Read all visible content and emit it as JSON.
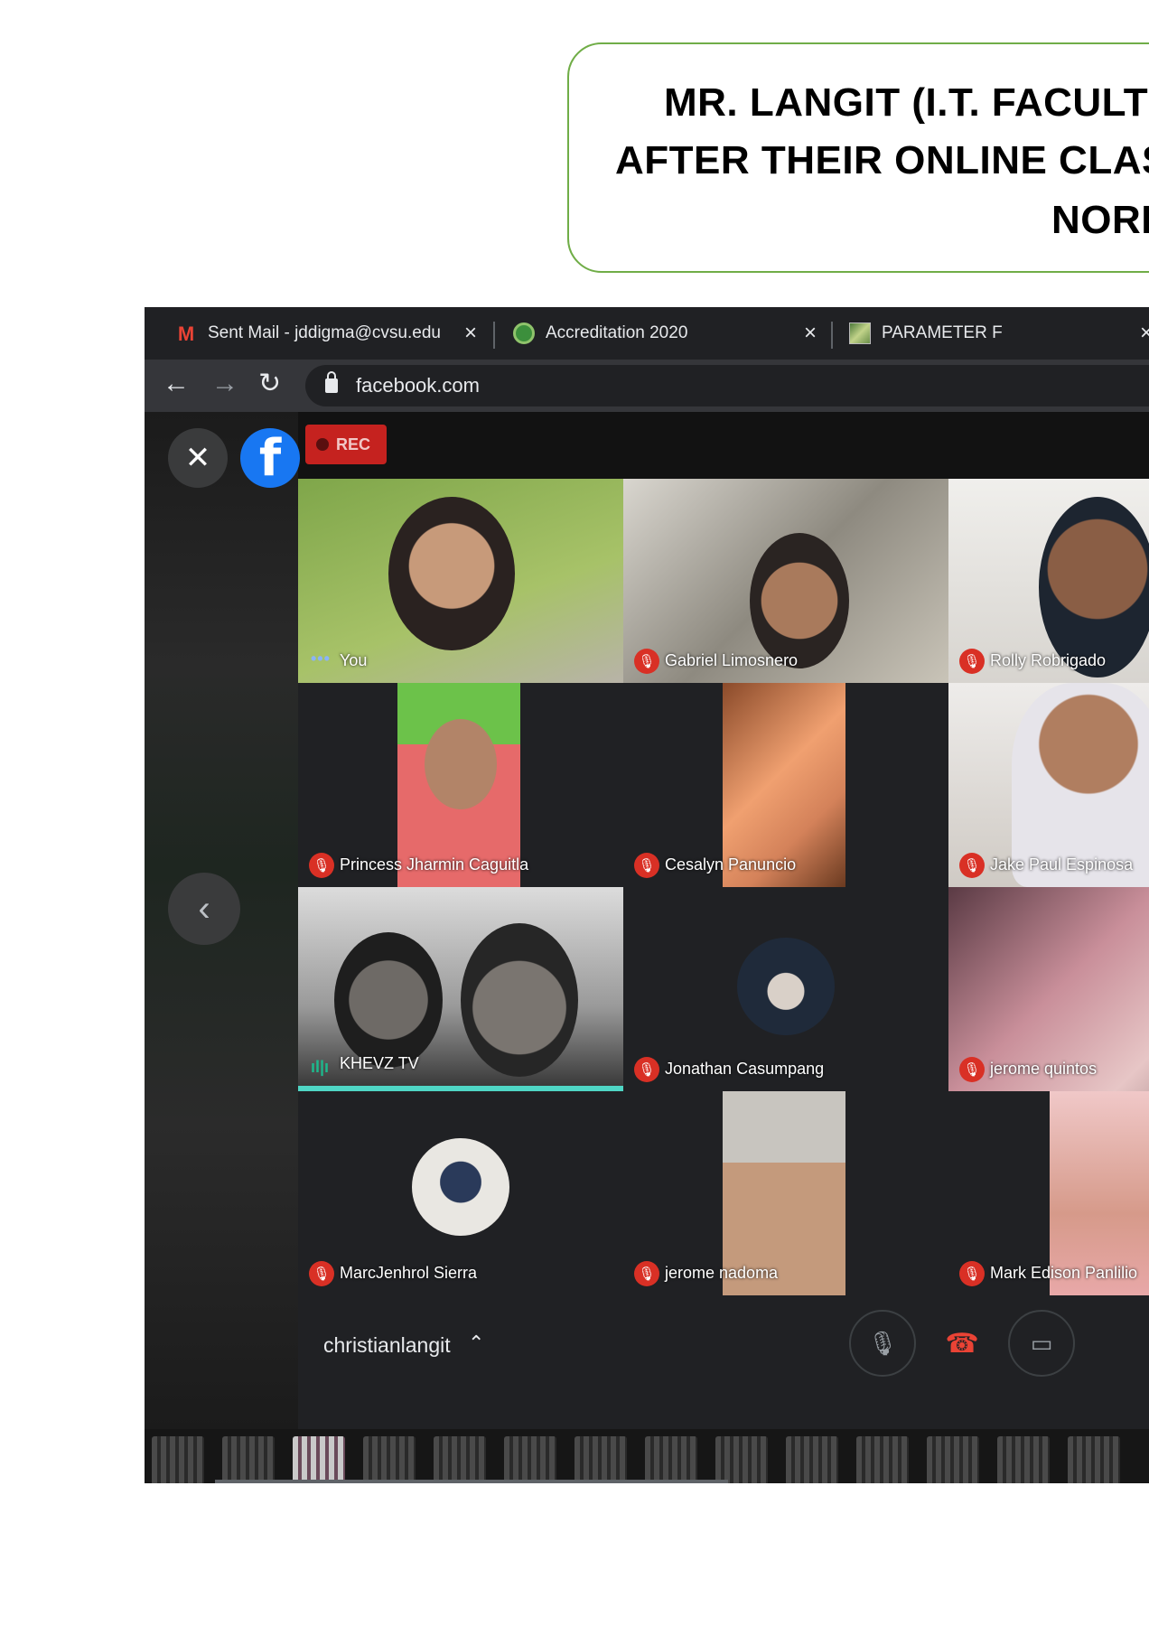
{
  "caption": {
    "line1": "MR. LANGIT (I.T. FACULT",
    "line2": "AFTER THEIR ONLINE CLAS",
    "line3": "NORI"
  },
  "browser": {
    "tabs": [
      {
        "title": "Sent Mail - jddigma@cvsu.edu",
        "icon": "gmail-icon"
      },
      {
        "title": "Accreditation 2020",
        "icon": "accreditation-icon"
      },
      {
        "title": "PARAMETER F",
        "icon": "parameter-image-icon"
      }
    ],
    "url": "facebook.com"
  },
  "call": {
    "rec_label": "REC",
    "self_name": "christianlangit",
    "participants": [
      {
        "name": "You",
        "status": "self"
      },
      {
        "name": "Gabriel Limosnero",
        "status": "muted"
      },
      {
        "name": "Rolly Robrigado",
        "status": "muted"
      },
      {
        "name": "Princess Jharmin Caguitla",
        "status": "muted"
      },
      {
        "name": "Cesalyn Panuncio",
        "status": "muted"
      },
      {
        "name": "Jake Paul Espinosa",
        "status": "muted"
      },
      {
        "name": "KHEVZ TV",
        "status": "speaking"
      },
      {
        "name": "Jonathan Casumpang",
        "status": "muted"
      },
      {
        "name": "jerome quintos",
        "status": "muted"
      },
      {
        "name": "MarcJenhrol Sierra",
        "status": "muted"
      },
      {
        "name": "jerome nadoma",
        "status": "muted"
      },
      {
        "name": "Mark Edison Panlilio",
        "status": "muted"
      }
    ]
  },
  "colors": {
    "caption_border": "#70ad47",
    "mute_red": "#d93025",
    "rec_red": "#c5221f",
    "active_speaker": "#4fd6c5",
    "facebook_blue": "#1877f2"
  }
}
